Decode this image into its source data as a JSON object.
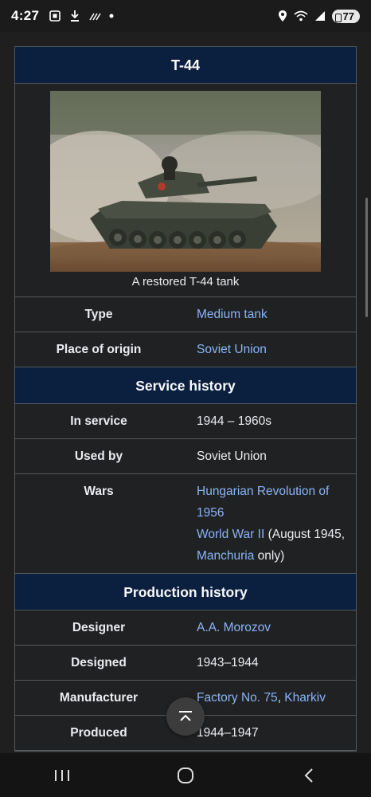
{
  "status_bar": {
    "time": "4:27",
    "battery": "77",
    "icons": [
      "screenshot-icon",
      "download-icon",
      "signal-slash-icon",
      "dot-icon",
      "location-icon",
      "wifi-icon",
      "cell-signal-icon",
      "battery-icon"
    ]
  },
  "infobox": {
    "title": "T-44",
    "image_caption": "A restored T-44 tank",
    "rows_general": [
      {
        "label": "Type",
        "value": "Medium tank",
        "link": true
      },
      {
        "label": "Place of origin",
        "value": "Soviet Union",
        "link": true
      }
    ],
    "service_history": {
      "header": "Service history",
      "in_service": {
        "label": "In service",
        "value": "1944 – 1960s"
      },
      "used_by": {
        "label": "Used by",
        "value": "Soviet Union"
      },
      "wars": {
        "label": "Wars",
        "war1": "Hungarian Revolution of 1956",
        "war2": "World War II",
        "war2_detail_a": " (August 1945, ",
        "war2_link": "Manchuria",
        "war2_detail_b": " only)"
      }
    },
    "production_history": {
      "header": "Production history",
      "designer": {
        "label": "Designer",
        "value": "A.A. Morozov"
      },
      "designed": {
        "label": "Designed",
        "value": "1943–1944"
      },
      "manufacturer": {
        "label": "Manufacturer",
        "value1": "Factory No. 75",
        "sep": ", ",
        "value2": "Kharkiv"
      },
      "produced": {
        "label": "Produced",
        "value": "1944–1947"
      }
    }
  },
  "colors": {
    "header_bg": "#0b1f3f",
    "link": "#8ab4f8",
    "page_bg": "#202122"
  }
}
